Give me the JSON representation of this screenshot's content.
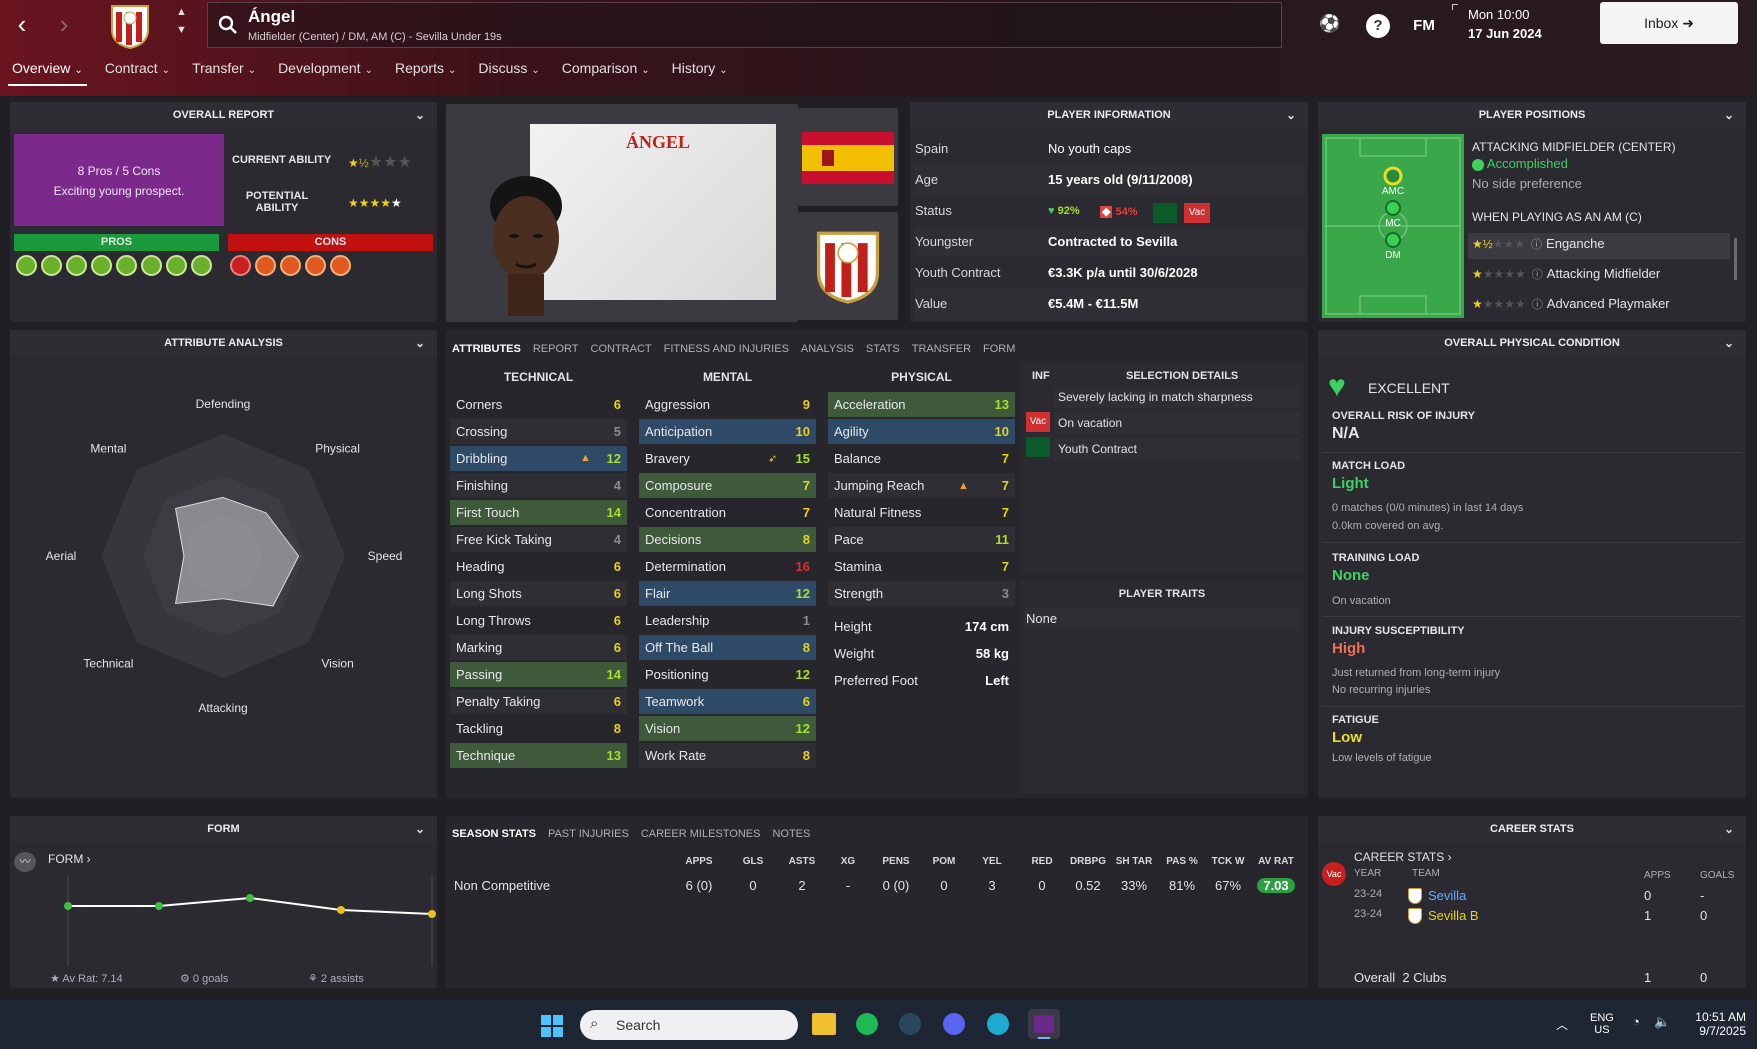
{
  "header": {
    "player_name": "Ángel",
    "player_subtitle": "Midfielder (Center) / DM, AM (C) - Sevilla Under 19s",
    "date_time": "Mon 10:00",
    "date": "17 Jun 2024",
    "fm_label": "FM",
    "inbox_label": "Inbox"
  },
  "nav_tabs": [
    "Overview",
    "Contract",
    "Transfer",
    "Development",
    "Reports",
    "Discuss",
    "Comparison",
    "History"
  ],
  "overall_report": {
    "title": "OVERALL REPORT",
    "summary_line1": "8 Pros / 5 Cons",
    "summary_line2": "Exciting young prospect.",
    "current_ability_label": "CURRENT ABILITY",
    "potential_ability_label": "POTENTIAL ABILITY",
    "current_ability_stars": 1.5,
    "potential_ability_stars": 5,
    "pros_label": "PROS",
    "cons_label": "CONS",
    "pros_count": 8,
    "cons_count": 5
  },
  "player_card": {
    "name": "ÁNGEL"
  },
  "player_info": {
    "title": "PLAYER INFORMATION",
    "rows": [
      {
        "k": "Spain",
        "v": "No youth caps"
      },
      {
        "k": "Age",
        "v": "15 years old (9/11/2008)"
      },
      {
        "k": "Status",
        "v": ""
      },
      {
        "k": "Youngster",
        "v": "Contracted to Sevilla"
      },
      {
        "k": "Youth Contract",
        "v": "€3.3K p/a until 30/6/2028"
      },
      {
        "k": "Value",
        "v": "€5.4M - €11.5M"
      }
    ],
    "status_pct1": "92%",
    "status_pct2": "54%",
    "status_vac": "Vac"
  },
  "positions": {
    "title": "PLAYER POSITIONS",
    "role_title": "ATTACKING MIDFIELDER (CENTER)",
    "role_level": "Accomplished",
    "side_pref": "No side preference",
    "when_playing": "WHEN PLAYING AS AN AM (C)",
    "pitch_labels": [
      "AMC",
      "MC",
      "DM"
    ],
    "roles": [
      {
        "name": "Enganche",
        "stars": 1.5
      },
      {
        "name": "Attacking Midfielder",
        "stars": 1
      },
      {
        "name": "Advanced Playmaker",
        "stars": 1
      }
    ]
  },
  "attr_analysis": {
    "title": "ATTRIBUTE ANALYSIS",
    "axes": [
      "Defending",
      "Physical",
      "Speed",
      "Vision",
      "Attacking",
      "Technical",
      "Aerial",
      "Mental"
    ],
    "values": [
      0.48,
      0.5,
      0.62,
      0.58,
      0.35,
      0.55,
      0.32,
      0.55
    ]
  },
  "attr_tabs": [
    "ATTRIBUTES",
    "REPORT",
    "CONTRACT",
    "FITNESS AND INJURIES",
    "ANALYSIS",
    "STATS",
    "TRANSFER",
    "FORM"
  ],
  "technical": {
    "title": "TECHNICAL",
    "items": [
      [
        "Corners",
        "6"
      ],
      [
        "Crossing",
        "5"
      ],
      [
        "Dribbling",
        "12"
      ],
      [
        "Finishing",
        "4"
      ],
      [
        "First Touch",
        "14"
      ],
      [
        "Free Kick Taking",
        "4"
      ],
      [
        "Heading",
        "6"
      ],
      [
        "Long Shots",
        "6"
      ],
      [
        "Long Throws",
        "6"
      ],
      [
        "Marking",
        "6"
      ],
      [
        "Passing",
        "14"
      ],
      [
        "Penalty Taking",
        "6"
      ],
      [
        "Tackling",
        "8"
      ],
      [
        "Technique",
        "13"
      ]
    ]
  },
  "mental": {
    "title": "MENTAL",
    "items": [
      [
        "Aggression",
        "9"
      ],
      [
        "Anticipation",
        "10"
      ],
      [
        "Bravery",
        "15"
      ],
      [
        "Composure",
        "7"
      ],
      [
        "Concentration",
        "7"
      ],
      [
        "Decisions",
        "8"
      ],
      [
        "Determination",
        "16"
      ],
      [
        "Flair",
        "12"
      ],
      [
        "Leadership",
        "1"
      ],
      [
        "Off The Ball",
        "8"
      ],
      [
        "Positioning",
        "12"
      ],
      [
        "Teamwork",
        "6"
      ],
      [
        "Vision",
        "12"
      ],
      [
        "Work Rate",
        "8"
      ]
    ]
  },
  "physical": {
    "title": "PHYSICAL",
    "items": [
      [
        "Acceleration",
        "13"
      ],
      [
        "Agility",
        "10"
      ],
      [
        "Balance",
        "7"
      ],
      [
        "Jumping Reach",
        "7"
      ],
      [
        "Natural Fitness",
        "7"
      ],
      [
        "Pace",
        "11"
      ],
      [
        "Stamina",
        "7"
      ],
      [
        "Strength",
        "3"
      ]
    ],
    "extra": [
      [
        "Height",
        "174 cm"
      ],
      [
        "Weight",
        "58 kg"
      ],
      [
        "Preferred Foot",
        "Left"
      ]
    ]
  },
  "selection": {
    "inf_label": "INF",
    "title": "SELECTION DETAILS",
    "items": [
      "Severely lacking in match sharpness",
      "On vacation",
      "Youth Contract"
    ],
    "vac": "Vac",
    "traits_title": "PLAYER TRAITS",
    "traits_value": "None"
  },
  "condition": {
    "title": "OVERALL PHYSICAL CONDITION",
    "state": "EXCELLENT",
    "risk_label": "OVERALL RISK OF INJURY",
    "risk_value": "N/A",
    "match_load_label": "MATCH LOAD",
    "match_load_value": "Light",
    "match_load_note1": "0 matches (0/0 minutes) in last 14 days",
    "match_load_note2": "0.0km covered on avg.",
    "training_label": "TRAINING LOAD",
    "training_value": "None",
    "training_note": "On vacation",
    "susc_label": "INJURY SUSCEPTIBILITY",
    "susc_value": "High",
    "susc_note1": "Just returned from long-term injury",
    "susc_note2": "No recurring injuries",
    "fatigue_label": "FATIGUE",
    "fatigue_value": "Low",
    "fatigue_note": "Low levels of fatigue"
  },
  "form": {
    "title": "FORM",
    "link": "FORM",
    "av_rat": "Av Rat: 7.14",
    "goals": "0 goals",
    "assists": "2 assists",
    "points": [
      0.6,
      0.6,
      0.68,
      0.56,
      0.52
    ]
  },
  "season": {
    "tabs": [
      "SEASON STATS",
      "PAST INJURIES",
      "CAREER MILESTONES",
      "NOTES"
    ],
    "headers": [
      "APPS",
      "GLS",
      "ASTS",
      "XG",
      "PENS",
      "POM",
      "YEL",
      "RED",
      "DRBPG",
      "SH TAR",
      "PAS %",
      "TCK W",
      "AV RAT"
    ],
    "row_label": "Non Competitive",
    "row": [
      "6 (0)",
      "0",
      "2",
      "-",
      "0 (0)",
      "0",
      "3",
      "0",
      "0.52",
      "33%",
      "81%",
      "67%",
      "7.03"
    ]
  },
  "career": {
    "title": "CAREER STATS",
    "link": "CAREER STATS",
    "vac": "Vac",
    "headers": [
      "YEAR",
      "TEAM",
      "APPS",
      "GOALS"
    ],
    "rows": [
      [
        "23-24",
        "Sevilla",
        "0",
        "-"
      ],
      [
        "23-24",
        "Sevilla B",
        "1",
        "0"
      ]
    ],
    "overall_label": "Overall",
    "overall_clubs": "2 Clubs",
    "overall_apps": "1",
    "overall_goals": "0"
  },
  "taskbar": {
    "search": "Search",
    "lang1": "ENG",
    "lang2": "US",
    "time": "10:51 AM",
    "date": "9/7/2025"
  }
}
